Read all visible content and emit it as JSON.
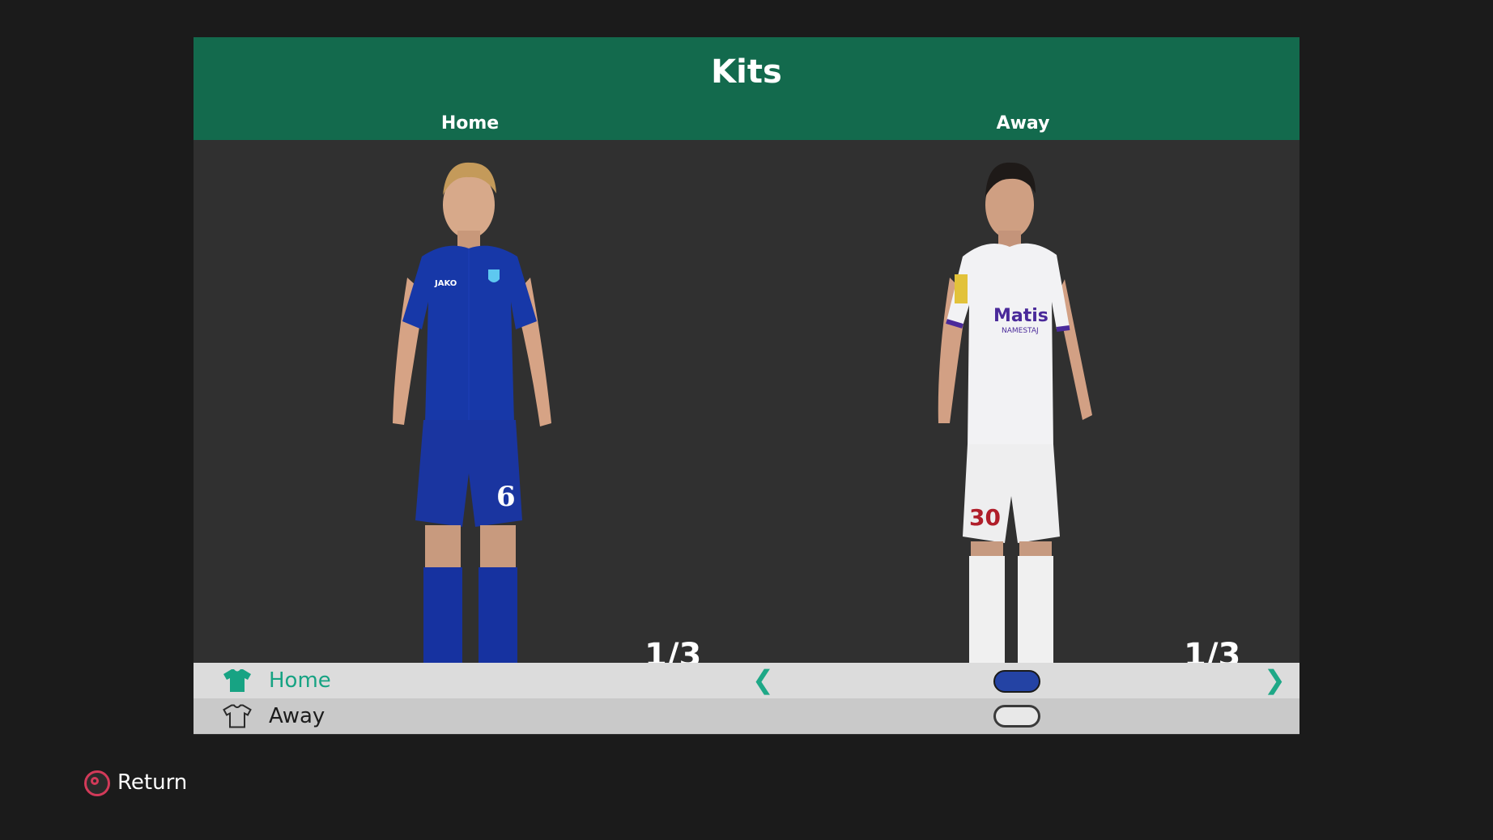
{
  "screen": {
    "title": "Kits",
    "columns": {
      "home_label": "Home",
      "away_label": "Away"
    }
  },
  "preview": {
    "home": {
      "counter": "1/3",
      "kit_colors": {
        "shirt": "#1738a8",
        "shorts": "#1a35a0",
        "socks": "#1632a0"
      },
      "shirt_number": "6",
      "brand_text": "JAKO"
    },
    "away": {
      "counter": "1/3",
      "kit_colors": {
        "shirt": "#f2f2f4",
        "shorts": "#eeeeef",
        "socks": "#f0f0f0",
        "trim": "#4a2a9a"
      },
      "shirt_number": "30",
      "sponsor_text": "Matis",
      "sponsor_subtext": "NAMESTAJ"
    }
  },
  "kit_list": [
    {
      "label": "Home",
      "icon": "tshirt-filled-icon",
      "selected": true,
      "swatch_color": "#2443a4"
    },
    {
      "label": "Away",
      "icon": "tshirt-outline-icon",
      "selected": false,
      "swatch_color": "#e8e8e8"
    }
  ],
  "footer": {
    "return_label": "Return",
    "button_icon": "circle-button-icon"
  },
  "colors": {
    "background": "#1b1b1b",
    "header": "#136a4d",
    "accent": "#17a383",
    "panel": "#303030"
  }
}
